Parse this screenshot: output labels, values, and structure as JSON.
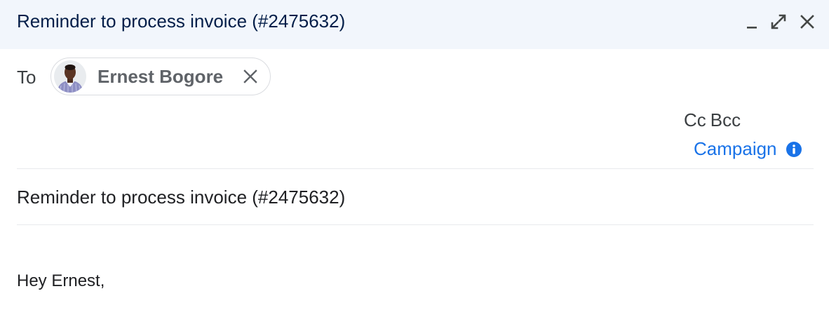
{
  "window": {
    "title": "Reminder to process invoice (#2475632)",
    "controls": [
      "minimize-icon",
      "expand-icon",
      "close-icon"
    ]
  },
  "recipients": {
    "to_label": "To",
    "chips": [
      {
        "name": "Ernest Bogore",
        "avatar": "avatar-photo",
        "remove_icon": "close-icon"
      }
    ]
  },
  "cc_bcc": {
    "cc_label": "Cc",
    "bcc_label": "Bcc"
  },
  "campaign": {
    "label": "Campaign",
    "icon": "info-icon",
    "color": "#1a73e8"
  },
  "subject": {
    "value": "Reminder to process invoice (#2475632)"
  },
  "body": {
    "text": "Hey Ernest,"
  },
  "colors": {
    "header_bg": "#f2f6fc",
    "title_text": "#041e49",
    "accent": "#1a73e8"
  }
}
